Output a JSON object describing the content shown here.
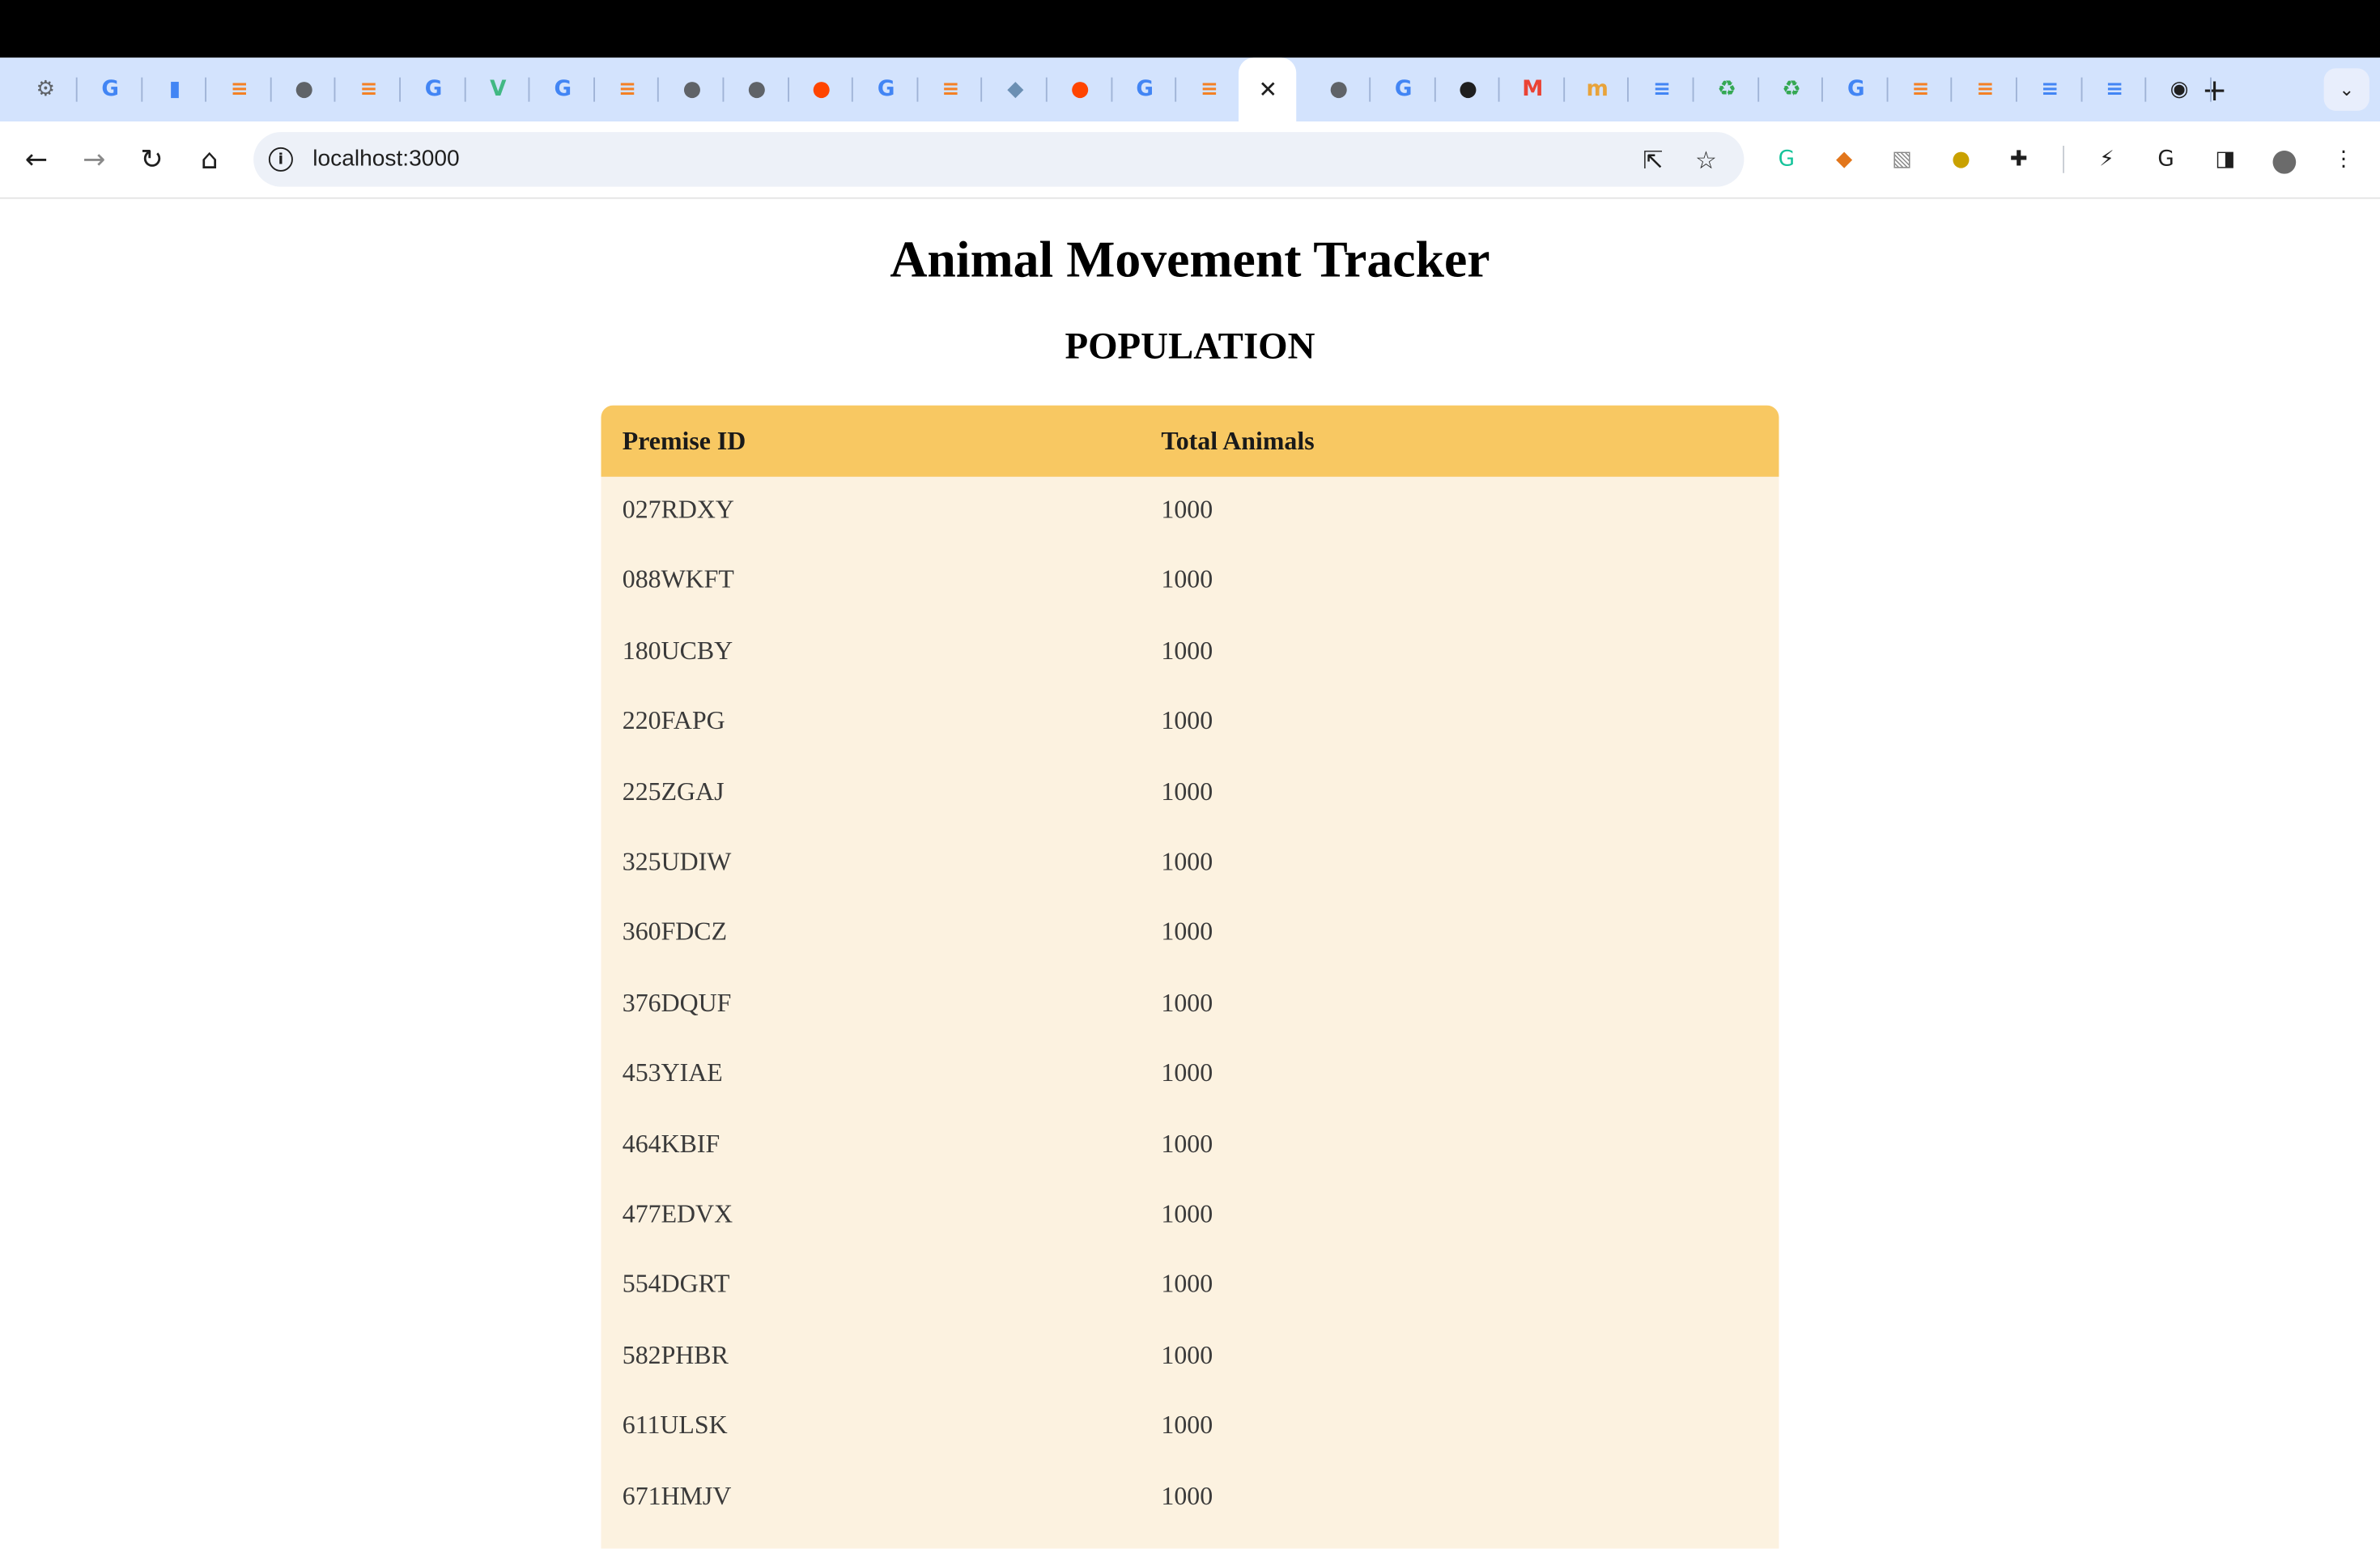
{
  "browser": {
    "tab_favicons": [
      {
        "name": "chatgpt-favicon",
        "glyph": "⚙",
        "color": "#5f6368"
      },
      {
        "name": "google-favicon",
        "glyph": "G",
        "color": "#4285f4"
      },
      {
        "name": "analytics-favicon",
        "glyph": "▮",
        "color": "#4285f4"
      },
      {
        "name": "stackoverflow-favicon",
        "glyph": "≡",
        "color": "#f48024"
      },
      {
        "name": "globe-favicon",
        "glyph": "●",
        "color": "#5f6368"
      },
      {
        "name": "stackoverflow-favicon",
        "glyph": "≡",
        "color": "#f48024"
      },
      {
        "name": "google-favicon",
        "glyph": "G",
        "color": "#4285f4"
      },
      {
        "name": "vue-favicon",
        "glyph": "V",
        "color": "#41b883"
      },
      {
        "name": "google-favicon",
        "glyph": "G",
        "color": "#4285f4"
      },
      {
        "name": "stackoverflow-favicon",
        "glyph": "≡",
        "color": "#f48024"
      },
      {
        "name": "globe-favicon",
        "glyph": "●",
        "color": "#5f6368"
      },
      {
        "name": "globe-favicon",
        "glyph": "●",
        "color": "#5f6368"
      },
      {
        "name": "reddit-favicon",
        "glyph": "●",
        "color": "#ff4500"
      },
      {
        "name": "google-favicon",
        "glyph": "G",
        "color": "#4285f4"
      },
      {
        "name": "stackoverflow-favicon",
        "glyph": "≡",
        "color": "#f48024"
      },
      {
        "name": "fish-favicon",
        "glyph": "◆",
        "color": "#6b8fb3"
      },
      {
        "name": "reddit-favicon",
        "glyph": "●",
        "color": "#ff4500"
      },
      {
        "name": "google-favicon",
        "glyph": "G",
        "color": "#4285f4"
      },
      {
        "name": "stackoverflow-favicon",
        "glyph": "≡",
        "color": "#f48024"
      }
    ],
    "active_tab_close": "✕",
    "tab_favicons_after": [
      {
        "name": "globe-favicon",
        "glyph": "●",
        "color": "#5f6368"
      },
      {
        "name": "google-favicon",
        "glyph": "G",
        "color": "#4285f4"
      },
      {
        "name": "github-favicon",
        "glyph": "●",
        "color": "#1f1f1f"
      },
      {
        "name": "gmail-favicon",
        "glyph": "M",
        "color": "#ea4335"
      },
      {
        "name": "moralis-favicon",
        "glyph": "m",
        "color": "#e8a33a"
      },
      {
        "name": "docs-favicon",
        "glyph": "≡",
        "color": "#4285f4"
      },
      {
        "name": "recycle-favicon",
        "glyph": "♻",
        "color": "#34a853"
      },
      {
        "name": "recycle-favicon",
        "glyph": "♻",
        "color": "#34a853"
      },
      {
        "name": "google-favicon",
        "glyph": "G",
        "color": "#4285f4"
      },
      {
        "name": "stackoverflow-favicon",
        "glyph": "≡",
        "color": "#f48024"
      },
      {
        "name": "stackoverflow-favicon",
        "glyph": "≡",
        "color": "#f48024"
      },
      {
        "name": "docs-favicon",
        "glyph": "≡",
        "color": "#4285f4"
      },
      {
        "name": "docs-favicon",
        "glyph": "≡",
        "color": "#4285f4"
      },
      {
        "name": "chrome-favicon",
        "glyph": "◉",
        "color": "#1f1f1f"
      }
    ],
    "new_tab_glyph": "+",
    "tab_menu_glyph": "⌄",
    "back_glyph": "←",
    "forward_glyph": "→",
    "reload_glyph": "↻",
    "home_glyph": "⌂",
    "info_glyph": "i",
    "url": "localhost:3000",
    "open_in_glyph": "⇱",
    "bookmark_glyph": "☆",
    "extensions": [
      {
        "name": "grammarly-icon",
        "glyph": "G",
        "color": "#15c39a"
      },
      {
        "name": "metamask-icon",
        "glyph": "◆",
        "color": "#e2761b"
      },
      {
        "name": "notion-ext-icon",
        "glyph": "▧",
        "color": "#888888"
      },
      {
        "name": "tampermonkey-icon",
        "glyph": "●",
        "color": "#c9a100"
      },
      {
        "name": "extensions-puzzle-icon",
        "glyph": "✚",
        "color": "#1f1f1f"
      }
    ],
    "extensions_right": [
      {
        "name": "performance-icon",
        "glyph": "⚡",
        "color": "#1f1f1f"
      },
      {
        "name": "google-account-icon",
        "glyph": "G",
        "color": "#1f1f1f"
      },
      {
        "name": "side-panel-icon",
        "glyph": "◨",
        "color": "#1f1f1f"
      },
      {
        "name": "profile-avatar",
        "glyph": "●",
        "color": "#6b6b6b"
      },
      {
        "name": "menu-kebab-icon",
        "glyph": "⋮",
        "color": "#1f1f1f"
      }
    ]
  },
  "page": {
    "title": "Animal Movement Tracker",
    "section": "POPULATION",
    "table": {
      "headers": [
        "Premise ID",
        "Total Animals"
      ],
      "rows": [
        [
          "027RDXY",
          "1000"
        ],
        [
          "088WKFT",
          "1000"
        ],
        [
          "180UCBY",
          "1000"
        ],
        [
          "220FAPG",
          "1000"
        ],
        [
          "225ZGAJ",
          "1000"
        ],
        [
          "325UDIW",
          "1000"
        ],
        [
          "360FDCZ",
          "1000"
        ],
        [
          "376DQUF",
          "1000"
        ],
        [
          "453YIAE",
          "1000"
        ],
        [
          "464KBIF",
          "1000"
        ],
        [
          "477EDVX",
          "1000"
        ],
        [
          "554DGRT",
          "1000"
        ],
        [
          "582PHBR",
          "1000"
        ],
        [
          "611ULSK",
          "1000"
        ],
        [
          "671HMJV",
          "1000"
        ]
      ]
    }
  },
  "colors": {
    "header_bg": "#f8c862",
    "row_bg": "#fcf2e0",
    "tabstrip_bg": "#d3e3fd"
  }
}
